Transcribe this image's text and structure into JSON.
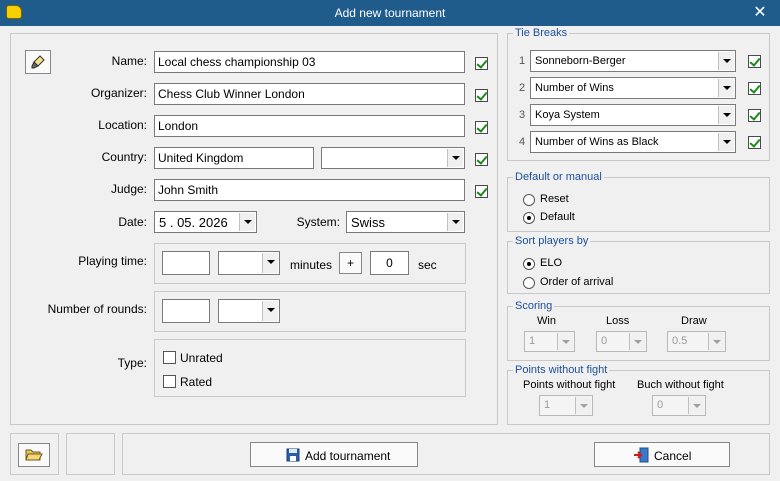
{
  "window": {
    "title": "Add new tournament",
    "close_glyph": "✕"
  },
  "form": {
    "name_label": "Name:",
    "name_value": "Local chess championship 03",
    "organizer_label": "Organizer:",
    "organizer_value": "Chess Club Winner London",
    "location_label": "Location:",
    "location_value": "London",
    "country_label": "Country:",
    "country_value": "United Kingdom",
    "country_select_value": "",
    "judge_label": "Judge:",
    "judge_value": "John Smith",
    "date_label": "Date:",
    "date_value": "5 . 05. 2026",
    "system_label": "System:",
    "system_value": "Swiss",
    "playing_time_label": "Playing time:",
    "minutes_label": "minutes",
    "plus_label": "+",
    "sec_value": "0",
    "sec_label": "sec",
    "rounds_label": "Number of rounds:",
    "type_label": "Type:",
    "type_unrated": "Unrated",
    "type_rated": "Rated"
  },
  "tie_breaks": {
    "title": "Tie Breaks",
    "items": [
      {
        "num": "1",
        "value": "Sonneborn-Berger",
        "checked": true
      },
      {
        "num": "2",
        "value": "Number of Wins",
        "checked": true
      },
      {
        "num": "3",
        "value": "Koya System",
        "checked": true
      },
      {
        "num": "4",
        "value": "Number of Wins as Black",
        "checked": true
      }
    ]
  },
  "default_manual": {
    "title": "Default or manual",
    "reset": "Reset",
    "default": "Default",
    "selected": "default"
  },
  "sort_players": {
    "title": "Sort players by",
    "elo": "ELO",
    "order": "Order of arrival",
    "selected": "elo"
  },
  "scoring": {
    "title": "Scoring",
    "win_label": "Win",
    "loss_label": "Loss",
    "draw_label": "Draw",
    "win": "1",
    "loss": "0",
    "draw": "0.5"
  },
  "points_without_fight": {
    "title": "Points without fight",
    "points_label": "Points without fight",
    "buch_label": "Buch without fight",
    "points": "1",
    "buch": "0"
  },
  "footer": {
    "add_label": "Add tournament",
    "cancel_label": "Cancel"
  }
}
